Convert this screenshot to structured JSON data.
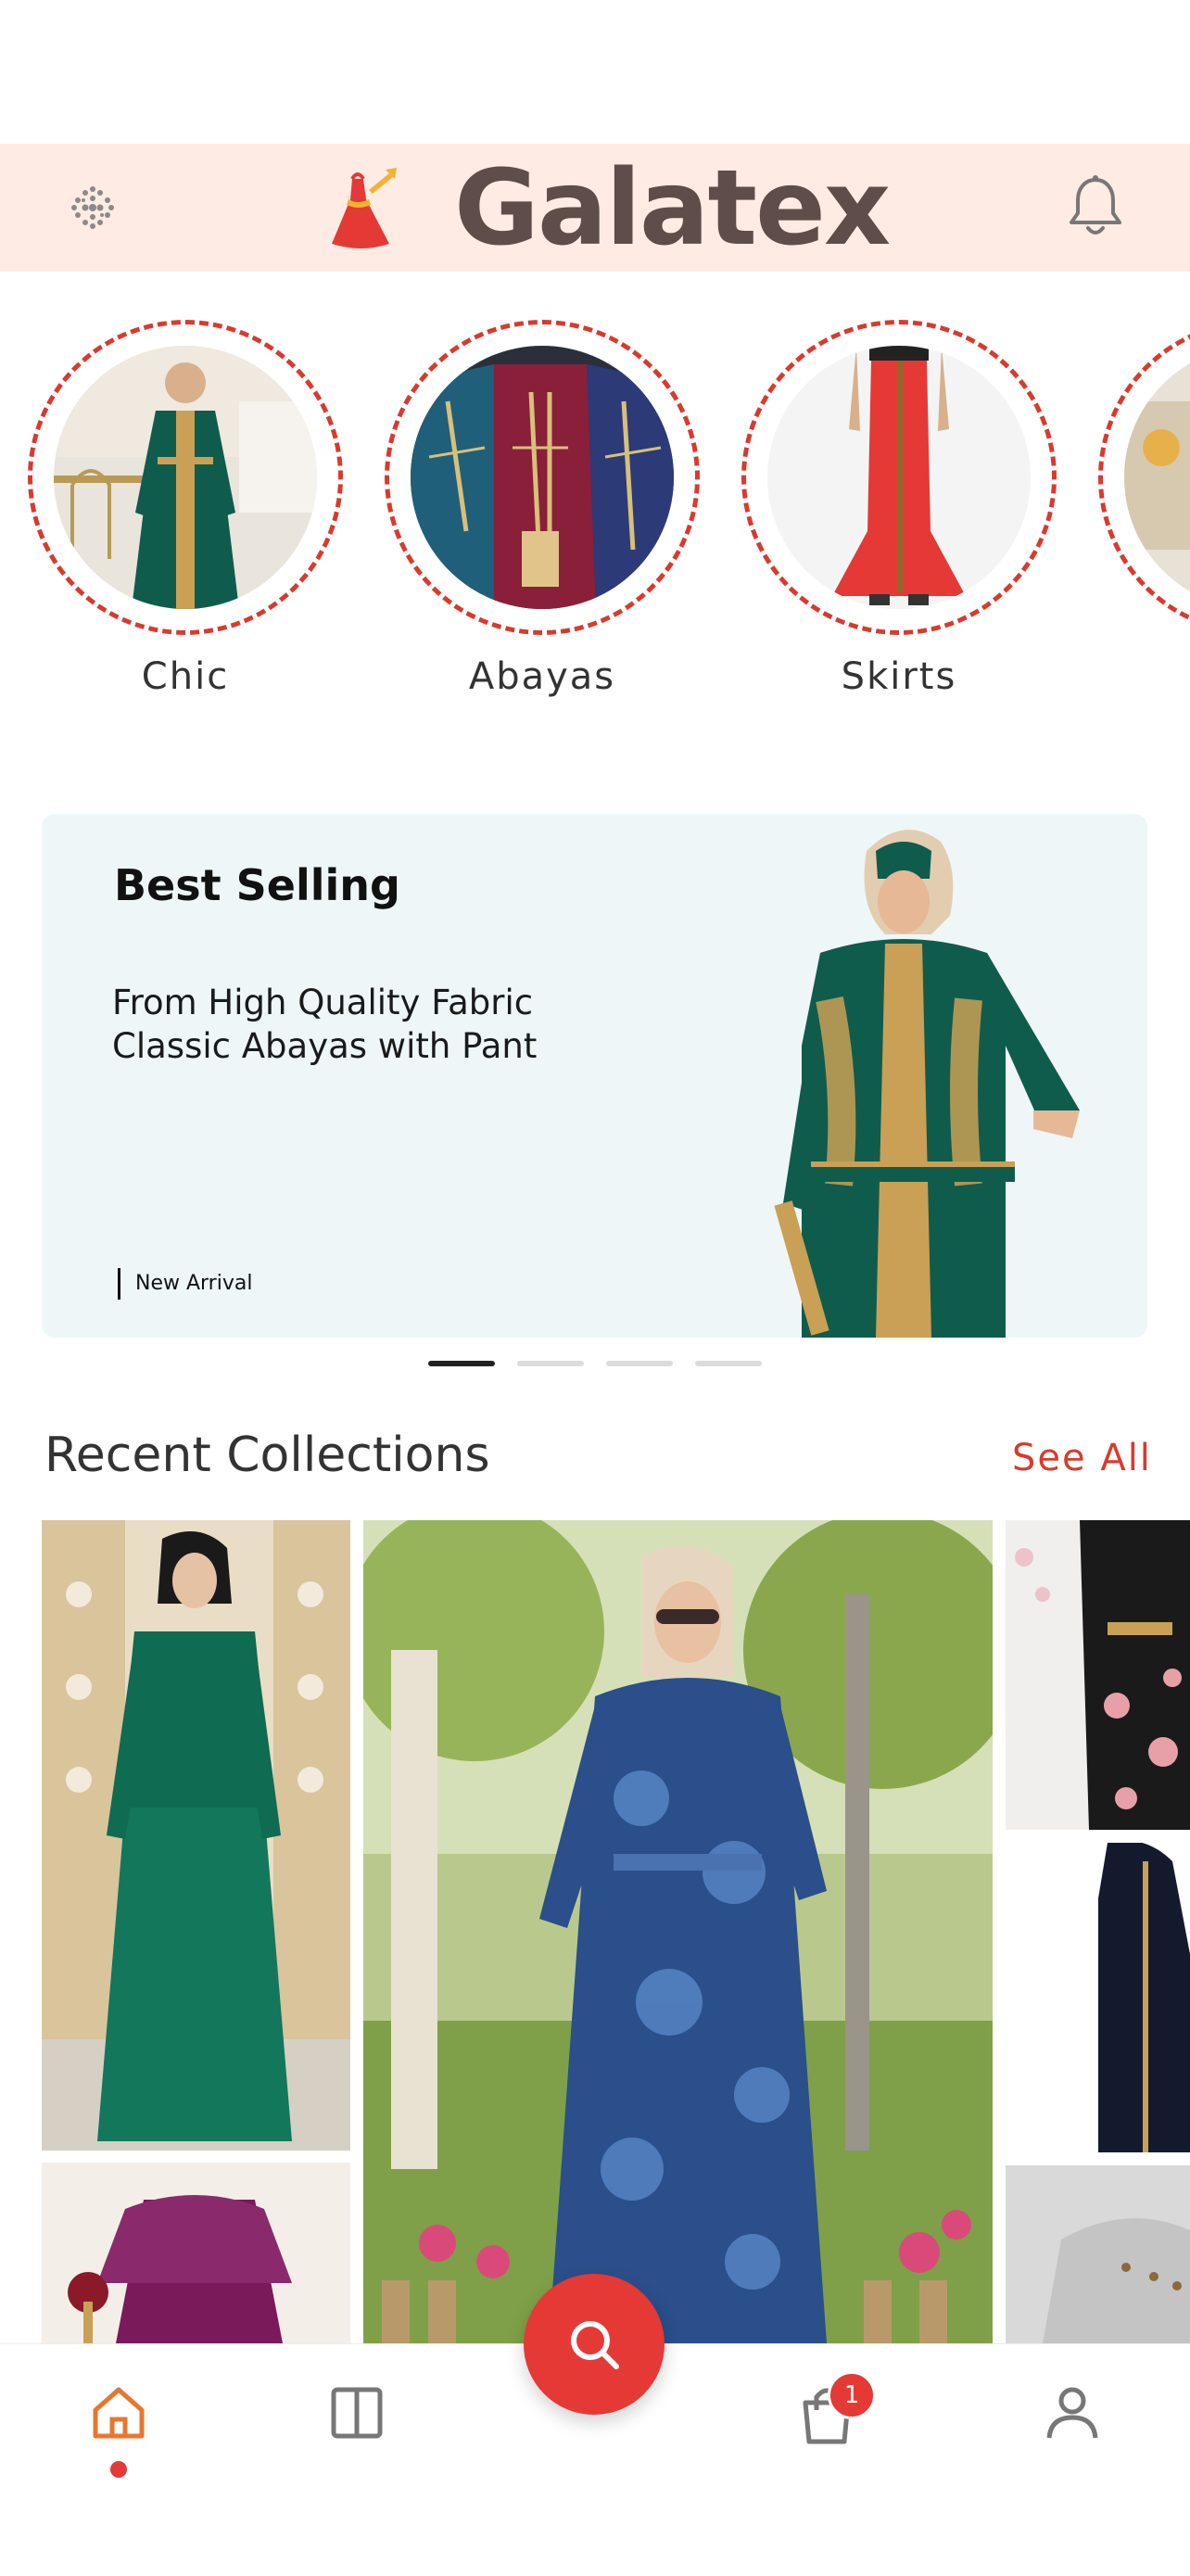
{
  "header": {
    "brand_name": "Galatex",
    "menu_icon": "grid-dots-icon",
    "notifications_icon": "bell-icon"
  },
  "categories": [
    {
      "label": "Chic"
    },
    {
      "label": "Abayas"
    },
    {
      "label": "Skirts"
    },
    {
      "label": ""
    }
  ],
  "banner": {
    "title": "Best Selling",
    "subtitle_line1": "From High Quality Fabric",
    "subtitle_line2": "Classic Abayas with Pant",
    "tag": "New Arrival",
    "slide_count": 4,
    "active_slide": 1
  },
  "recent": {
    "title": "Recent Collections",
    "see_all": "See All"
  },
  "bottom_nav": {
    "items": [
      "home-icon",
      "catalog-icon",
      "search-icon",
      "cart-icon",
      "profile-icon"
    ],
    "active": "home-icon",
    "cart_badge": "1"
  },
  "colors": {
    "accent": "#e53935",
    "header_bg": "#fdebe4",
    "brand_text": "#5e4d49",
    "banner_bg": "#eef6f8"
  }
}
